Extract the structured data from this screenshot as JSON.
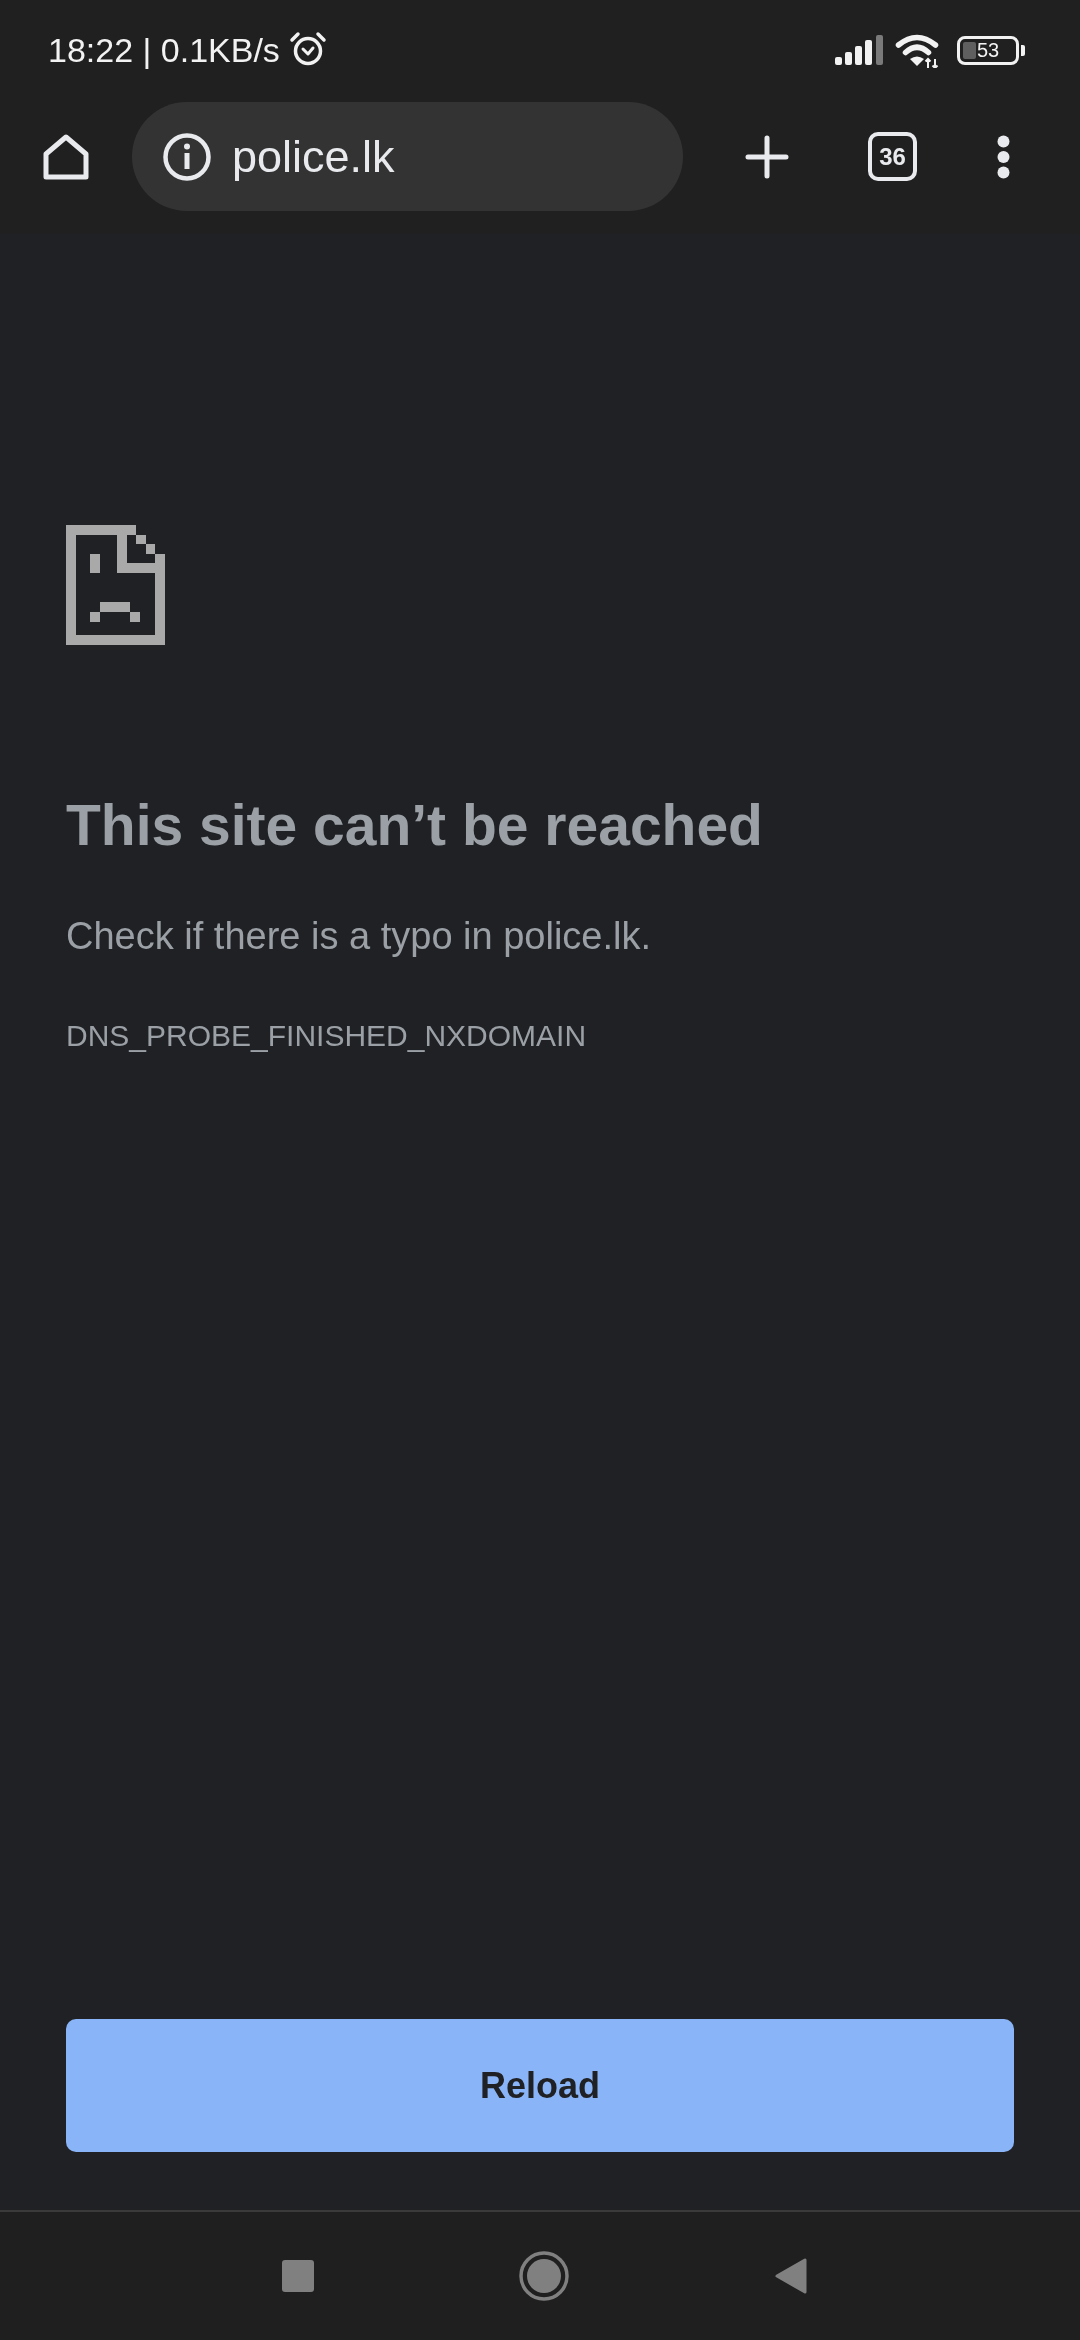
{
  "status_bar": {
    "time_speed": "18:22 | 0.1KB/s",
    "battery": "53"
  },
  "toolbar": {
    "url": "police.lk",
    "tab_count": "36"
  },
  "error_page": {
    "title": "This site can’t be reached",
    "message": "Check if there is a typo in police.lk.",
    "error_code": "DNS_PROBE_FINISHED_NXDOMAIN"
  },
  "buttons": [
    {
      "label": "Reload"
    }
  ]
}
